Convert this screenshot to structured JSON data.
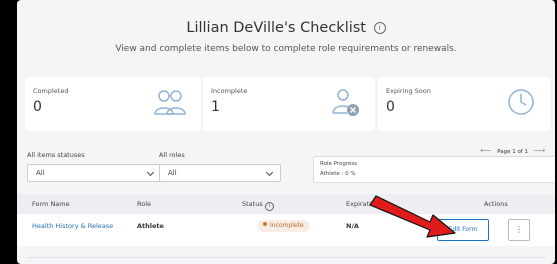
{
  "header": {
    "title": "Lillian DeVille's Checklist",
    "info_glyph": "i",
    "subtitle": "View and complete items below to complete role requirements or renewals."
  },
  "cards": [
    {
      "label": "Completed",
      "value": "0",
      "icon": "users-icon"
    },
    {
      "label": "Incomplete",
      "value": "1",
      "icon": "user-remove-icon"
    },
    {
      "label": "Expiring Soon",
      "value": "0",
      "icon": "clock-icon"
    }
  ],
  "filters": {
    "status_label": "All items statuses",
    "status_value": "All",
    "role_label": "All roles",
    "role_value": "All"
  },
  "role_progress": {
    "title": "Role Progress",
    "detail": "Athlete : 0 %"
  },
  "pager": {
    "prev": "⟵",
    "text": "Page 1 of 1",
    "next": "⟶"
  },
  "table": {
    "headers": {
      "form_name": "Form Name",
      "role": "Role",
      "status": "Status",
      "expiration": "Expiration D",
      "actions": "Actions"
    },
    "rows": [
      {
        "form_name": "Health History & Release",
        "role": "Athlete",
        "status": "Incomplete",
        "expiration": "N/A",
        "edit_label": "Edit Form",
        "more_label": "⋮"
      }
    ]
  },
  "colors": {
    "accent": "#1a73c8",
    "link": "#2271b3",
    "annotation_arrow": "#e01b1b",
    "incomplete_badge": "#b86a2a"
  }
}
